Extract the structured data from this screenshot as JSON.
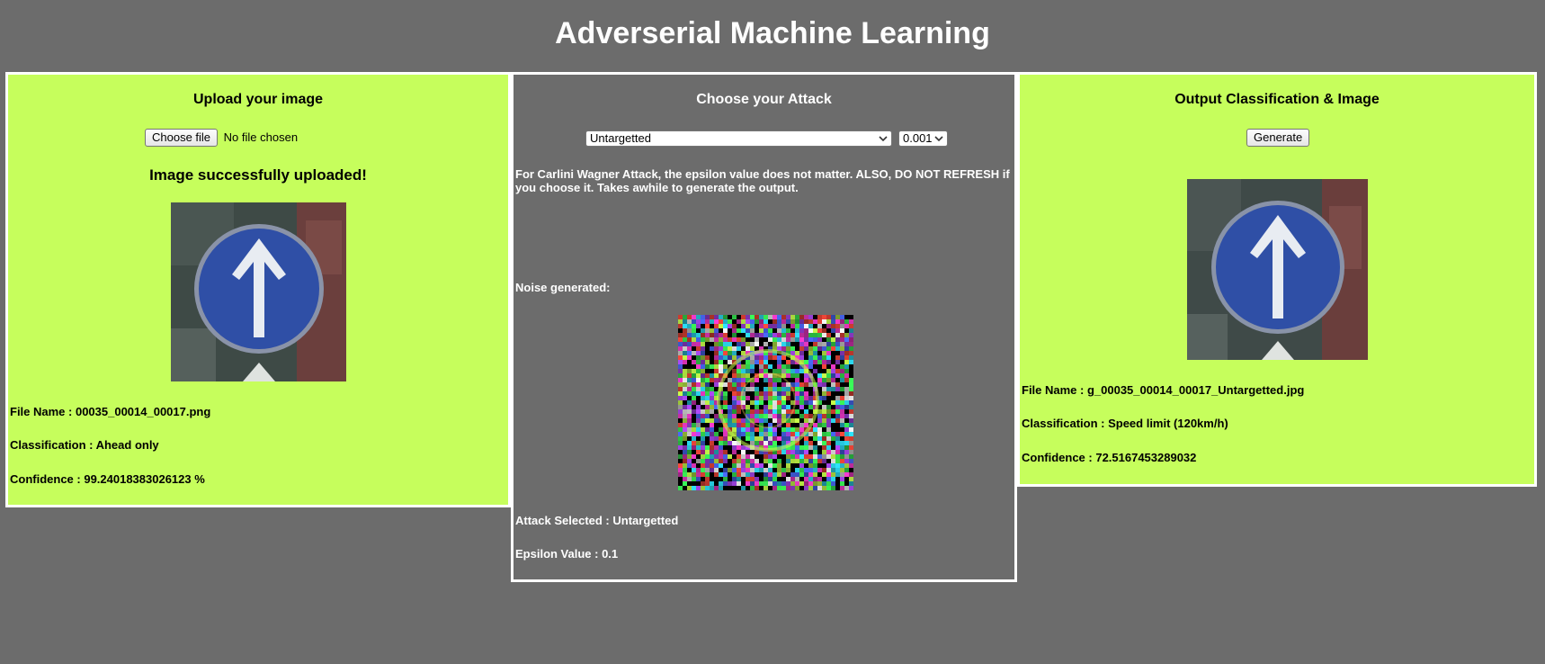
{
  "page": {
    "title": "Adverserial Machine Learning"
  },
  "upload": {
    "heading": "Upload your image",
    "choose_label": "Choose file",
    "no_file_text": "No file chosen",
    "success_msg": "Image successfully uploaded!",
    "file_name": "File Name : 00035_00014_00017.png",
    "classification": "Classification : Ahead only",
    "confidence": "Confidence : 99.24018383026123 %"
  },
  "attack": {
    "heading": "Choose your Attack",
    "attack_select_value": "Untargetted",
    "epsilon_select_value": "0.001",
    "note": "For Carlini Wagner Attack, the epsilon value does not matter. ALSO, DO NOT REFRESH if you choose it. Takes awhile to generate the output.",
    "noise_label": "Noise generated:",
    "attack_selected": "Attack Selected : Untargetted",
    "epsilon_value": "Epsilon Value : 0.1"
  },
  "output": {
    "heading": "Output Classification & Image",
    "generate_label": "Generate",
    "file_name": "File Name : g_00035_00014_00017_Untargetted.jpg",
    "classification": "Classification : Speed limit (120km/h)",
    "confidence": "Confidence : 72.5167453289032"
  },
  "colors": {
    "background": "#6c6c6c",
    "panel_green": "#c6fe5c",
    "sign_blue": "#2f4fa6",
    "border": "#ffffff"
  },
  "icons": {
    "sign_image": "ahead-only-sign",
    "noise_image": "noise-pattern",
    "dropdown": "chevron-down-icon"
  }
}
